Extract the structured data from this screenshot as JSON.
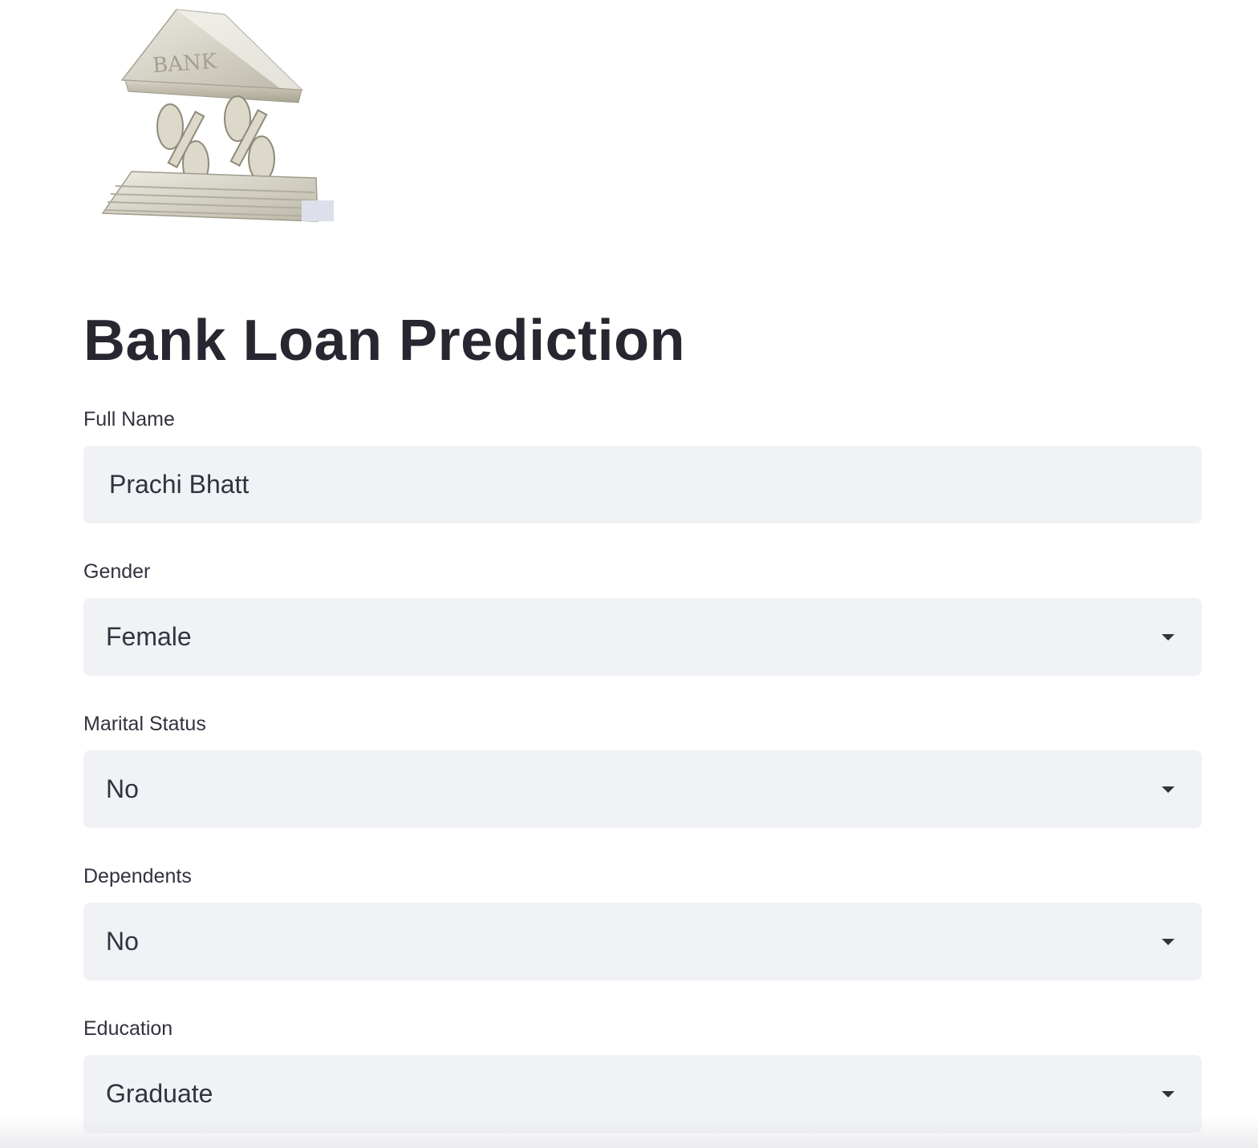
{
  "app": {
    "title": "Bank Loan Prediction"
  },
  "logo": {
    "icon": "bank-building-percent-icon",
    "text": "BANK"
  },
  "form": {
    "full_name": {
      "label": "Full Name",
      "value": "Prachi Bhatt"
    },
    "gender": {
      "label": "Gender",
      "value": "Female"
    },
    "marital_status": {
      "label": "Marital Status",
      "value": "No"
    },
    "dependents": {
      "label": "Dependents",
      "value": "No"
    },
    "education": {
      "label": "Education",
      "value": "Graduate"
    }
  },
  "colors": {
    "input_background": "#f0f2f6",
    "text": "#262730",
    "label": "#31333f"
  }
}
